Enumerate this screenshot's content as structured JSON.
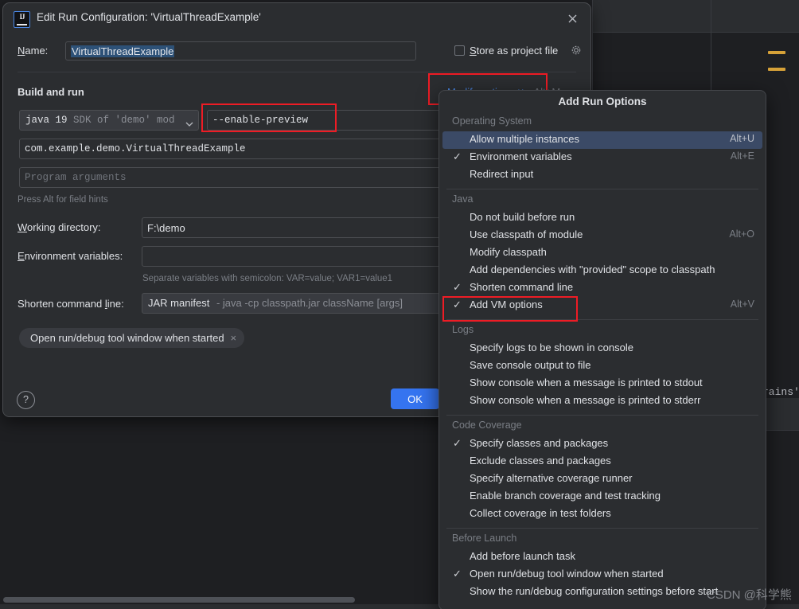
{
  "dialog": {
    "title": "Edit Run Configuration: 'VirtualThreadExample'",
    "app_icon": "intellij-idea-logo-icon",
    "close_icon": "close-icon",
    "name_label": "Name:",
    "name_value": "VirtualThreadExample",
    "store_as_project_file_label": "Store as project file",
    "store_gear_icon": "gear-icon",
    "build_and_run_section": "Build and run",
    "modify_options_label": "Modify options",
    "modify_options_shortcut": "Alt+M",
    "modify_options_chevron": "chevron-down-icon",
    "jre_combo_main": "java 19",
    "jre_combo_sub": "SDK of 'demo' mod",
    "jre_combo_chevron": "chevron-down-icon",
    "vm_options_value": "--enable-preview",
    "main_class_value": "com.example.demo.VirtualThreadExample",
    "program_arguments_placeholder": "Program arguments",
    "alt_hint": "Press Alt for field hints",
    "working_directory_label": "Working directory:",
    "working_directory_value": "F:\\demo",
    "environment_variables_label": "Environment variables:",
    "environment_variables_value": "",
    "environment_variables_hint": "Separate variables with semicolon: VAR=value; VAR1=value1",
    "shorten_command_line_label": "Shorten command line:",
    "shorten_command_line_value": "JAR manifest",
    "shorten_command_line_desc": "- java -cp classpath.jar className [args]",
    "shorten_chevron": "chevron-down-icon",
    "before_launch_chip": "Open run/debug tool window when started",
    "before_launch_chip_close": "×",
    "help_button": "?",
    "ok_button": "OK"
  },
  "popup": {
    "title": "Add Run Options",
    "groups": [
      {
        "label": "Operating System",
        "items": [
          {
            "label": "Allow multiple instances",
            "shortcut": "Alt+U",
            "checked": false,
            "selected": true
          },
          {
            "label": "Environment variables",
            "shortcut": "Alt+E",
            "checked": true,
            "selected": false
          },
          {
            "label": "Redirect input",
            "shortcut": "",
            "checked": false,
            "selected": false
          }
        ]
      },
      {
        "label": "Java",
        "items": [
          {
            "label": "Do not build before run",
            "shortcut": "",
            "checked": false,
            "selected": false
          },
          {
            "label": "Use classpath of module",
            "shortcut": "Alt+O",
            "checked": false,
            "selected": false
          },
          {
            "label": "Modify classpath",
            "shortcut": "",
            "checked": false,
            "selected": false
          },
          {
            "label": "Add dependencies with \"provided\" scope to classpath",
            "shortcut": "",
            "checked": false,
            "selected": false
          },
          {
            "label": "Shorten command line",
            "shortcut": "",
            "checked": true,
            "selected": false
          },
          {
            "label": "Add VM options",
            "shortcut": "Alt+V",
            "checked": true,
            "selected": false
          }
        ]
      },
      {
        "label": "Logs",
        "items": [
          {
            "label": "Specify logs to be shown in console",
            "shortcut": "",
            "checked": false,
            "selected": false
          },
          {
            "label": "Save console output to file",
            "shortcut": "",
            "checked": false,
            "selected": false
          },
          {
            "label": "Show console when a message is printed to stdout",
            "shortcut": "",
            "checked": false,
            "selected": false
          },
          {
            "label": "Show console when a message is printed to stderr",
            "shortcut": "",
            "checked": false,
            "selected": false
          }
        ]
      },
      {
        "label": "Code Coverage",
        "items": [
          {
            "label": "Specify classes and packages",
            "shortcut": "",
            "checked": true,
            "selected": false
          },
          {
            "label": "Exclude classes and packages",
            "shortcut": "",
            "checked": false,
            "selected": false
          },
          {
            "label": "Specify alternative coverage runner",
            "shortcut": "",
            "checked": false,
            "selected": false
          },
          {
            "label": "Enable branch coverage and test tracking",
            "shortcut": "",
            "checked": false,
            "selected": false
          },
          {
            "label": "Collect coverage in test folders",
            "shortcut": "",
            "checked": false,
            "selected": false
          }
        ]
      },
      {
        "label": "Before Launch",
        "items": [
          {
            "label": "Add before launch task",
            "shortcut": "",
            "checked": false,
            "selected": false
          },
          {
            "label": "Open run/debug tool window when started",
            "shortcut": "",
            "checked": true,
            "selected": false
          },
          {
            "label": "Show the run/debug configuration settings before start",
            "shortcut": "",
            "checked": false,
            "selected": false
          }
        ]
      }
    ]
  },
  "background": {
    "editor_fragment": "rains'",
    "watermark": "CSDN @科学熊"
  },
  "colors": {
    "accent_blue": "#3574f0",
    "link_blue": "#4a88e8",
    "annotation_red": "#ee1c25",
    "selection_blue": "#3b4a66",
    "dialog_bg": "#2b2d30",
    "editor_bg": "#1e1f22",
    "warning_marker": "#d6a138"
  }
}
